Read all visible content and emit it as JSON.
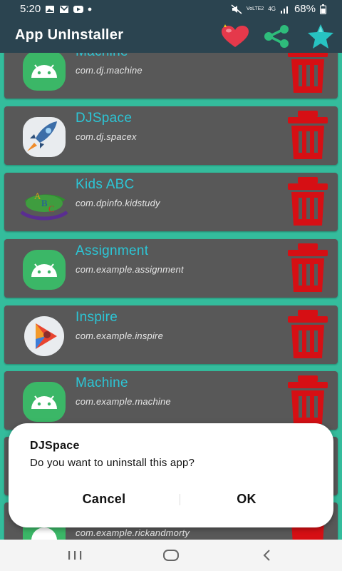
{
  "status_bar": {
    "time": "5:20",
    "battery_percent": "68%",
    "network": "4G",
    "carrier_tag": "VoLTE2",
    "left_icons": [
      "image-icon",
      "mail-icon",
      "youtube-icon",
      "dot-icon"
    ],
    "right_icons": [
      "mute-icon",
      "volte-icon",
      "network-icon",
      "signal-icon",
      "battery-icon"
    ]
  },
  "app_bar": {
    "title": "App UnInstaller",
    "actions": [
      "heart-icon",
      "share-icon",
      "star-icon"
    ],
    "colors": {
      "heart": "#e5394b",
      "share": "#2ebc7b",
      "star": "#27c3c2"
    }
  },
  "apps": [
    {
      "name": "Machine",
      "package": "com.dj.machine",
      "icon": "android-icon"
    },
    {
      "name": "DJSpace",
      "package": "com.dj.spacex",
      "icon": "rocket-icon"
    },
    {
      "name": "Kids ABC",
      "package": "com.dpinfo.kidstudy",
      "icon": "abc-icon"
    },
    {
      "name": "Assignment",
      "package": "com.example.assignment",
      "icon": "android-icon"
    },
    {
      "name": "Inspire",
      "package": "com.example.inspire",
      "icon": "play-icon"
    },
    {
      "name": "Machine",
      "package": "com.example.machine",
      "icon": "android-icon"
    },
    {
      "name": "",
      "package": "",
      "icon": "android-icon"
    },
    {
      "name": "",
      "package": "com.example.rickandmorty",
      "icon": "android-icon"
    }
  ],
  "dialog": {
    "title": "DJSpace",
    "message": "Do you want to uninstall this app?",
    "cancel": "Cancel",
    "ok": "OK"
  },
  "nav_bar": {
    "buttons": [
      "recent-apps-icon",
      "home-icon",
      "back-icon"
    ]
  },
  "colors": {
    "app_bar": "#2b4450",
    "background": "#34bc9c",
    "card": "#585858",
    "app_name": "#2cc6d6",
    "trash": "#d60f14"
  }
}
